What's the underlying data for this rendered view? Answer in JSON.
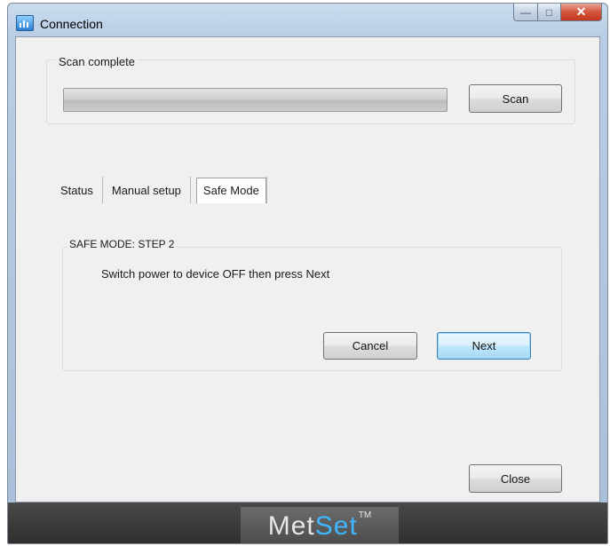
{
  "window": {
    "title": "Connection",
    "controls": {
      "minimize": "—",
      "maximize": "□",
      "close": "✕"
    }
  },
  "scan": {
    "group_label": "Scan complete",
    "progress": 1.0,
    "scan_button": "Scan"
  },
  "tabs": [
    {
      "label": "Status",
      "active": false
    },
    {
      "label": "Manual setup",
      "active": false
    },
    {
      "label": "Safe Mode",
      "active": true
    }
  ],
  "safe_mode": {
    "group_label": "SAFE MODE: STEP 2",
    "instruction": "Switch power to device OFF  then press Next",
    "cancel_button": "Cancel",
    "next_button": "Next"
  },
  "footer": {
    "close_button": "Close",
    "brand_main": "Met",
    "brand_accent": "Set",
    "brand_tm": "TM"
  },
  "colors": {
    "brand_accent": "#3fb6ff",
    "footer_bg": "#3b3b3b",
    "focus_border": "#3c7fb1"
  }
}
